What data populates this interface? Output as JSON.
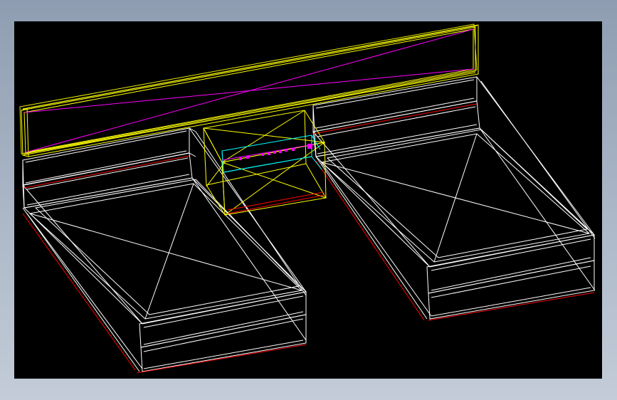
{
  "scene": {
    "background_color": "#000000",
    "frame_color": "#a7b3c4",
    "objects": [
      {
        "name": "headboard",
        "color": "#ffff00",
        "accent_color": "#ff00ff"
      },
      {
        "name": "bed-left",
        "color": "#ffffff",
        "edge_color": "#ff0000"
      },
      {
        "name": "bed-right",
        "color": "#ffffff",
        "edge_color": "#ff0000"
      },
      {
        "name": "nightstand",
        "color": "#ffff00",
        "accent_color": "#00ffff"
      }
    ]
  }
}
